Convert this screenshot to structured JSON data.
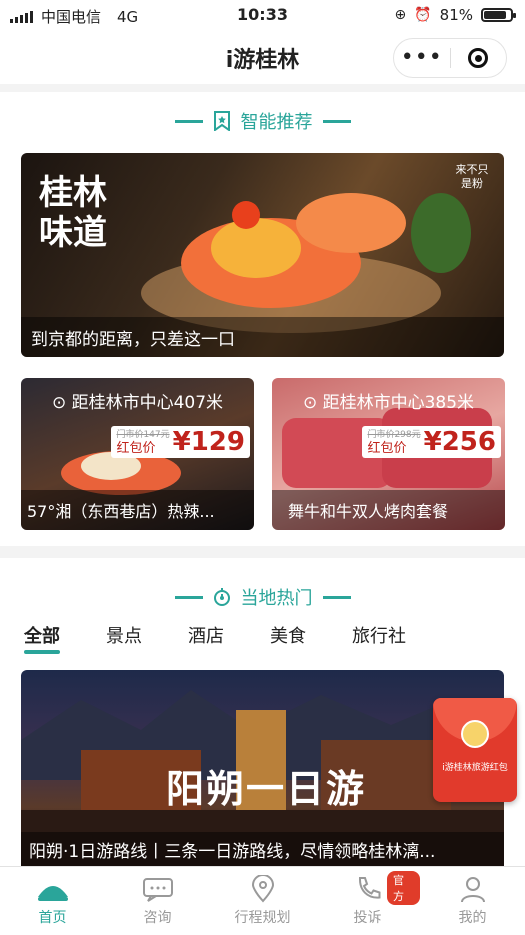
{
  "status_bar": {
    "carrier": "中国电信",
    "network": "4G",
    "time": "10:33",
    "battery": "81%"
  },
  "nav": {
    "title": "i游桂林",
    "more": "•••"
  },
  "recommend": {
    "title": "智能推荐",
    "banner": {
      "caption": "到京都的距离，只差这一口",
      "art_title": "桂林味道",
      "art_tag": "来不只是粉"
    },
    "cards": [
      {
        "distance": "距桂林市中心407米",
        "original_price": "门市价147元",
        "price_label": "红包价",
        "price": "¥129",
        "name": "57°湘（东西巷店）热辣..."
      },
      {
        "distance": "距桂林市中心385米",
        "original_price": "门市价298元",
        "price_label": "红包价",
        "price": "¥256",
        "name": "舞牛和牛双人烤肉套餐"
      }
    ]
  },
  "hot": {
    "title": "当地热门",
    "tabs": [
      "全部",
      "景点",
      "酒店",
      "美食",
      "旅行社"
    ],
    "active_tab": "全部",
    "banner": {
      "art_title": "阳朔一日游",
      "caption": "阳朔·1日游路线丨三条一日游路线，尽情领略桂林漓..."
    },
    "red_packet": "i游桂林旅游红包"
  },
  "tabbar": {
    "items": [
      {
        "label": "首页",
        "icon": "home-icon",
        "active": true
      },
      {
        "label": "咨询",
        "icon": "chat-icon",
        "active": false
      },
      {
        "label": "行程规划",
        "icon": "location-icon",
        "active": false
      },
      {
        "label": "投诉",
        "icon": "phone-icon",
        "active": false,
        "badge": "官方"
      },
      {
        "label": "我的",
        "icon": "user-icon",
        "active": false
      }
    ]
  },
  "colors": {
    "accent": "#2aa59a",
    "price_red": "#c0231c",
    "badge_red": "#e03c2a"
  }
}
